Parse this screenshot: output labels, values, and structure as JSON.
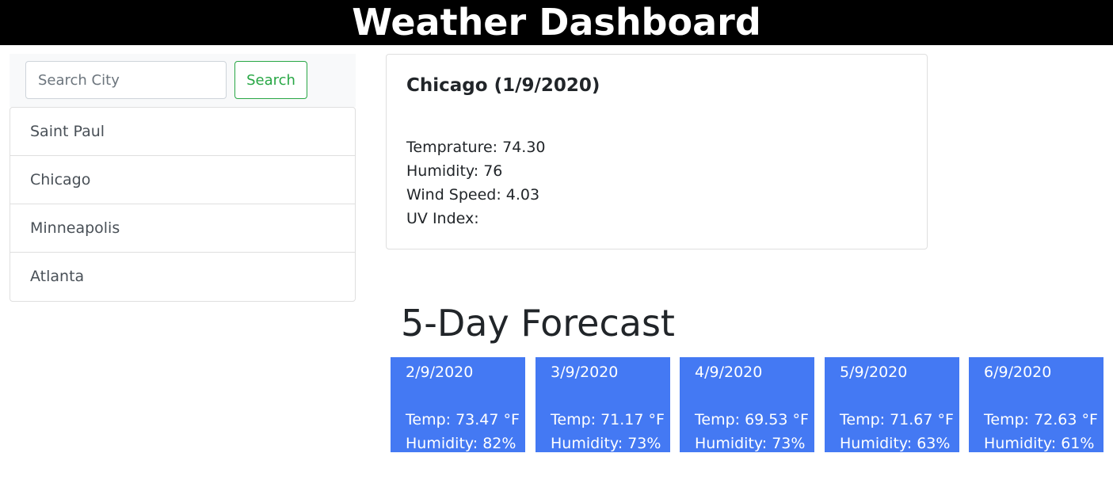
{
  "header": {
    "title": "Weather Dashboard"
  },
  "search": {
    "placeholder": "Search City",
    "value": "",
    "button_label": "Search"
  },
  "cities": [
    "Saint Paul",
    "Chicago",
    "Minneapolis",
    "Atlanta"
  ],
  "current": {
    "title": "Chicago (1/9/2020)",
    "temperature": "Temprature: 74.30",
    "humidity": "Humidity: 76",
    "wind": "Wind Speed: 4.03",
    "uv": "UV Index:"
  },
  "forecast": {
    "heading": "5-Day Forecast",
    "card_color": "#4479f3",
    "days": [
      {
        "date": "2/9/2020",
        "temp": "Temp: 73.47 °F",
        "humidity": "Humidity: 82%"
      },
      {
        "date": "3/9/2020",
        "temp": "Temp: 71.17 °F",
        "humidity": "Humidity: 73%"
      },
      {
        "date": "4/9/2020",
        "temp": "Temp: 69.53 °F",
        "humidity": "Humidity: 73%"
      },
      {
        "date": "5/9/2020",
        "temp": "Temp: 71.67 °F",
        "humidity": "Humidity: 63%"
      },
      {
        "date": "6/9/2020",
        "temp": "Temp: 72.63 °F",
        "humidity": "Humidity: 61%"
      }
    ]
  }
}
